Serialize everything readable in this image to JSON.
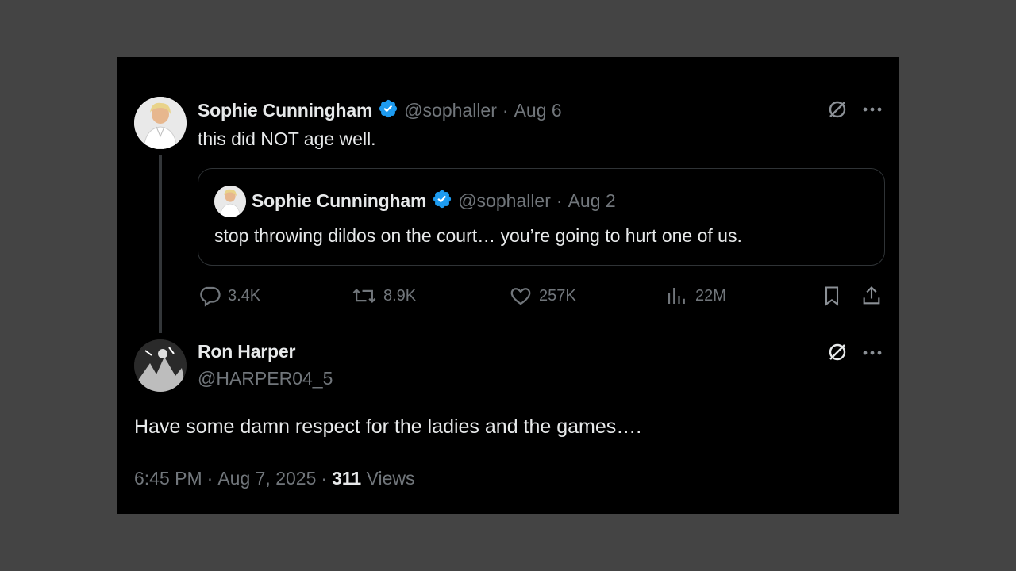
{
  "tweet": {
    "author_name": "Sophie Cunningham",
    "handle": "@sophaller",
    "separator": "·",
    "date": "Aug 6",
    "text": "this did NOT age well.",
    "quote": {
      "author_name": "Sophie Cunningham",
      "handle": "@sophaller",
      "separator": "·",
      "date": "Aug 2",
      "text": "stop throwing dildos on the court… you’re going to hurt one of us."
    },
    "actions": {
      "replies": "3.4K",
      "reposts": "8.9K",
      "likes": "257K",
      "views": "22M"
    }
  },
  "reply": {
    "author_name": "Ron Harper",
    "handle": "@HARPER04_5",
    "text": "Have some damn respect for the ladies and the games….",
    "time": "6:45 PM",
    "separator": "·",
    "date": "Aug 7, 2025",
    "separator2": "·",
    "views_count": "311",
    "views_label": "Views"
  },
  "colors": {
    "background": "#000000",
    "page": "#444444",
    "primary_text": "#e7e9ea",
    "secondary_text": "#71767b",
    "verified": "#1d9bf0"
  },
  "icons": [
    "verified-badge-icon",
    "grok-icon",
    "more-icon",
    "reply-icon",
    "repost-icon",
    "like-icon",
    "views-icon",
    "bookmark-icon",
    "share-icon"
  ]
}
